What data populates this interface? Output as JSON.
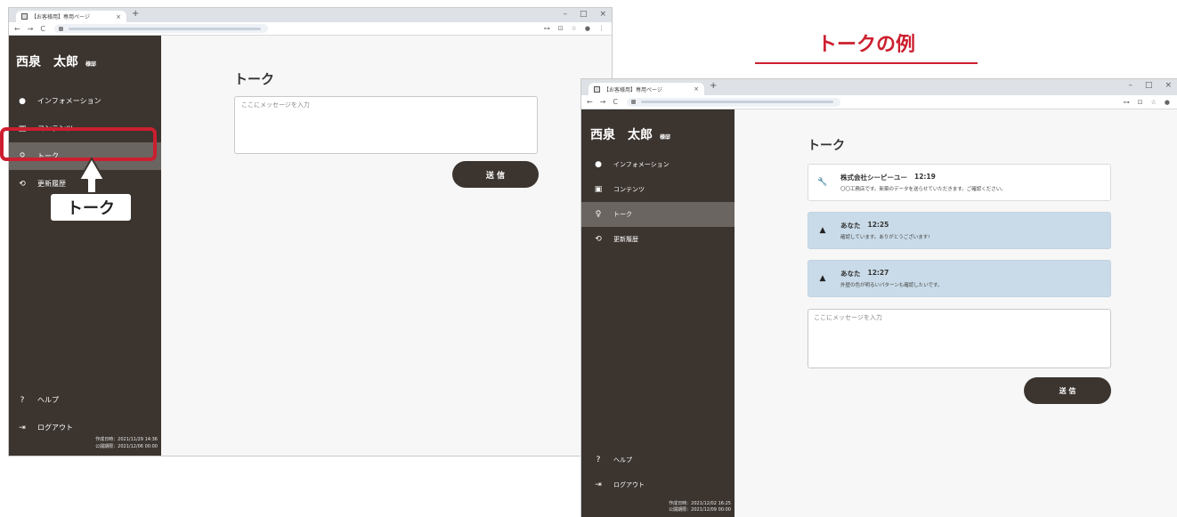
{
  "browser": {
    "tab_title": "【お客様用】専用ページ",
    "tab_close": "×",
    "new_tab": "+",
    "win_controls": [
      "–",
      "□",
      "×"
    ],
    "nav_icons": [
      "←",
      "→",
      "C"
    ],
    "toolbar_icons": [
      "⊶",
      "⊡",
      "☆",
      "●",
      "⋮"
    ]
  },
  "sidebar": {
    "user_name": "西泉　太郎",
    "honorific": "様邸",
    "items": [
      {
        "id": "information",
        "label": "インフォメーション",
        "icon": "info-icon",
        "glyph": "●"
      },
      {
        "id": "contents",
        "label": "コンテンツ",
        "icon": "image-icon",
        "glyph": "▣"
      },
      {
        "id": "talk",
        "label": "トーク",
        "icon": "chat-bubbles-icon",
        "glyph": "♀"
      },
      {
        "id": "history",
        "label": "更新履歴",
        "icon": "history-icon",
        "glyph": "⟲"
      }
    ],
    "help": {
      "label": "ヘルプ",
      "icon": "help-icon",
      "glyph": "?"
    },
    "logout": {
      "label": "ログアウト",
      "icon": "logout-icon",
      "glyph": "⇥"
    }
  },
  "window1": {
    "created": "作成日時：2021/11/29 14:36",
    "published": "公開期限：2021/12/06 00:00"
  },
  "window2": {
    "created": "作成日時：2021/12/02 16:25",
    "published": "公開期限：2021/12/09 00:00"
  },
  "main": {
    "page_title": "トーク",
    "message_placeholder": "ここにメッセージを入力",
    "send_label": "送 信"
  },
  "callout": {
    "label": "トーク"
  },
  "example": {
    "title": "トークの例"
  },
  "talk": {
    "messages": [
      {
        "type": "company",
        "icon": "wrench-icon",
        "sender": "株式会社シーピーユー",
        "time": "12:19",
        "body": "〇〇工務店です。新築のデータを送らせていただきます。ご確認ください。"
      },
      {
        "type": "mine",
        "icon": "person-icon",
        "sender": "あなた",
        "time": "12:25",
        "body": "確認しています。ありがとうございます!"
      },
      {
        "type": "mine",
        "icon": "person-icon",
        "sender": "あなた",
        "time": "12:27",
        "body": "外壁の色が明るいパターンも確認したいです。"
      }
    ]
  },
  "colors": {
    "sidebar_bg": "#3b342f",
    "sidebar_active": "#6b6561",
    "accent_red": "#cc1f2f",
    "my_message_bg": "#c9dbe8"
  }
}
